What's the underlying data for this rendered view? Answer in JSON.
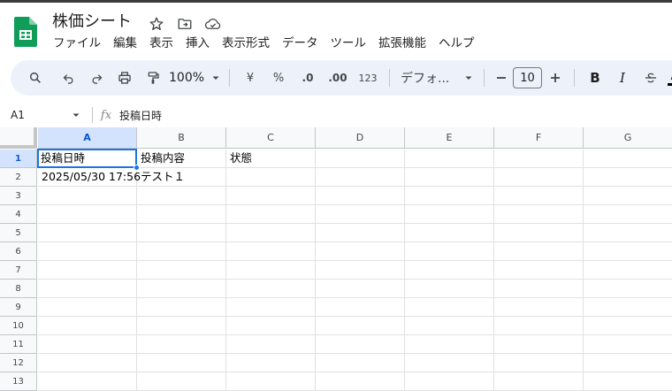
{
  "window": {
    "title": "株価シート"
  },
  "title_icons": [
    "star-icon",
    "move-to-folder-icon",
    "cloud-status-icon"
  ],
  "menu": [
    "ファイル",
    "編集",
    "表示",
    "挿入",
    "表示形式",
    "データ",
    "ツール",
    "拡張機能",
    "ヘルプ"
  ],
  "toolbar": {
    "zoom": "100%",
    "currency": "¥",
    "percent": "%",
    "decrease_decimal": ".0",
    "increase_decimal": ".00",
    "number_format": "123",
    "font": "デフォ...",
    "font_size": "10"
  },
  "formula_bar": {
    "name_box": "A1",
    "fx": "fx",
    "content": "投稿日時"
  },
  "columns": [
    "A",
    "B",
    "C",
    "D",
    "E",
    "F",
    "G"
  ],
  "rows": [
    "1",
    "2",
    "3",
    "4",
    "5",
    "6",
    "7",
    "8",
    "9",
    "10",
    "11",
    "12",
    "13"
  ],
  "cells": {
    "A1": "投稿日時",
    "B1": "投稿内容",
    "C1": "状態",
    "A2": "2025/05/30 17:56",
    "B2": "テスト１"
  },
  "selected_cell": "A1",
  "colors": {
    "selection": "#1a73e8",
    "header_selected": "#d3e3fd",
    "toolbar_bg": "#edf2fa",
    "logo": "#0f9d58"
  }
}
